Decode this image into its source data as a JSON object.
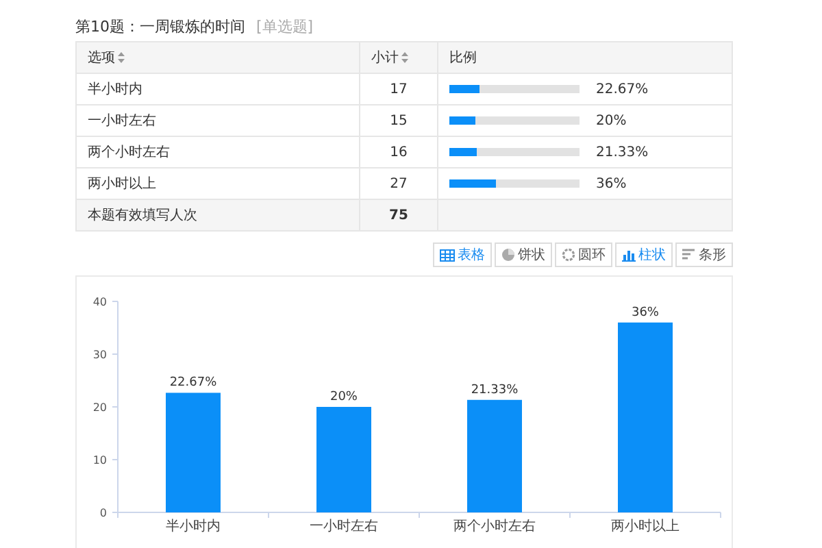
{
  "question": {
    "title": "第10题：一周锻炼的时间",
    "type_tag": "[单选题]"
  },
  "table": {
    "columns": [
      {
        "label": "选项",
        "sortable": true
      },
      {
        "label": "小计",
        "sortable": true
      },
      {
        "label": "比例",
        "sortable": false
      }
    ],
    "rows": [
      {
        "option": "半小时内",
        "count": "17",
        "level": 0.2267,
        "percent": "22.67%"
      },
      {
        "option": "一小时左右",
        "count": "15",
        "level": 0.2,
        "percent": "20%"
      },
      {
        "option": "两个小时左右",
        "count": "16",
        "level": 0.2133,
        "percent": "21.33%"
      },
      {
        "option": "两小时以上",
        "count": "27",
        "level": 0.36,
        "percent": "36%"
      }
    ],
    "total": {
      "label": "本题有效填写人次",
      "count": "75"
    }
  },
  "view_buttons": [
    {
      "kind": "table",
      "label": "表格",
      "selected": true
    },
    {
      "kind": "pie",
      "label": "饼状",
      "selected": false
    },
    {
      "kind": "ring",
      "label": "圆环",
      "selected": false
    },
    {
      "kind": "column",
      "label": "柱状",
      "selected": true
    },
    {
      "kind": "bar",
      "label": "条形",
      "selected": false
    }
  ],
  "chart": {
    "chart_data": {
      "type": "bar",
      "categories": [
        "半小时内",
        "一小时左右",
        "两个小时左右",
        "两小时以上"
      ],
      "values": [
        22.67,
        20,
        21.33,
        36
      ],
      "yticks": [
        0,
        10,
        20,
        30,
        40
      ],
      "ylim": [
        0,
        40
      ],
      "data_labels": true,
      "value_labels": [
        "22.67%",
        "20%",
        "21.33%",
        "36%"
      ]
    }
  }
}
